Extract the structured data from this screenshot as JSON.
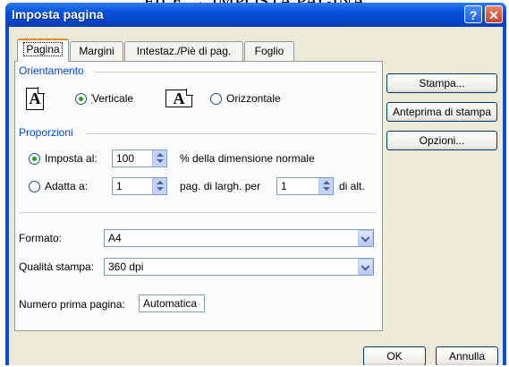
{
  "document_heading": "FILE → IMPOSTA PAGINA",
  "window": {
    "title": "Imposta pagina",
    "help_label": "?",
    "close_label": "✕"
  },
  "tabs": [
    {
      "label": "Pagina",
      "active": true
    },
    {
      "label": "Margini",
      "active": false
    },
    {
      "label": "Intestaz./Piè di pag.",
      "active": false
    },
    {
      "label": "Foglio",
      "active": false
    }
  ],
  "orientamento": {
    "group_label": "Orientamento",
    "portrait_icon_letter": "A",
    "landscape_icon_letter": "A",
    "portrait": {
      "label": "Verticale",
      "selected": true
    },
    "landscape": {
      "label": "Orizzontale",
      "selected": false
    }
  },
  "proporzioni": {
    "group_label": "Proporzioni",
    "imposta": {
      "label": "Imposta al:",
      "value": "100",
      "suffix": "% della dimensione normale",
      "selected": true
    },
    "adatta": {
      "label": "Adatta a:",
      "value_wide": "1",
      "middle_text": "pag. di largh. per",
      "value_tall": "1",
      "suffix": "di alt.",
      "selected": false
    }
  },
  "formato": {
    "label": "Formato:",
    "value": "A4"
  },
  "qualita": {
    "label": "Qualità stampa:",
    "value": "360 dpi"
  },
  "numero_prima_pagina": {
    "label": "Numero prima pagina:",
    "value": "Automatica"
  },
  "side_buttons": {
    "stampa": "Stampa...",
    "anteprima": "Anteprima di stampa",
    "opzioni": "Opzioni..."
  },
  "footer_buttons": {
    "ok": "OK",
    "annulla": "Annulla"
  },
  "colors": {
    "title_bar": "#0a4fd6",
    "group_label": "#0046d5",
    "dialog_bg": "#ece9d8",
    "active_tab_accent": "#e68b2c"
  }
}
